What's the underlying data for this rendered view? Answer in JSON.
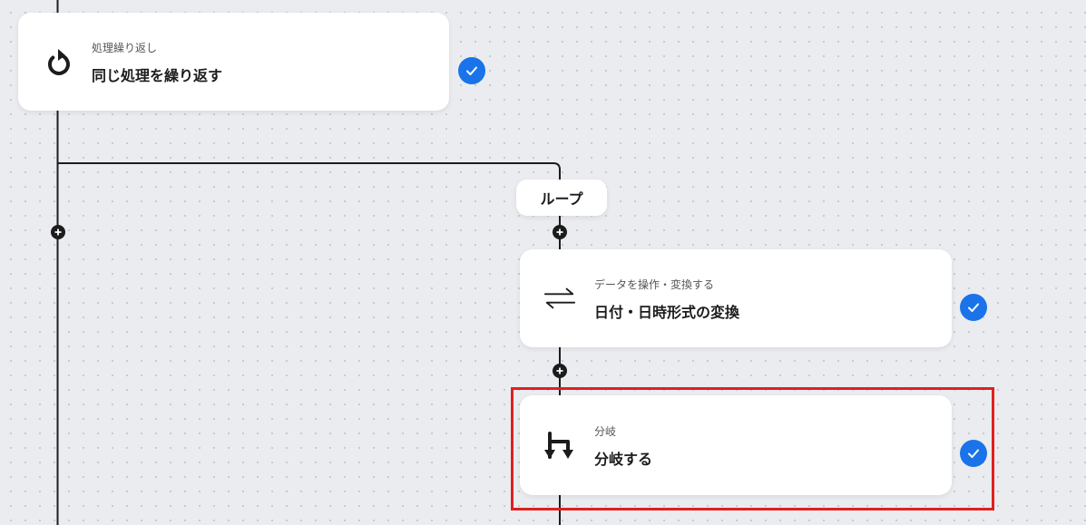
{
  "flow": {
    "repeat_card": {
      "subtitle": "処理繰り返し",
      "title": "同じ処理を繰り返す",
      "icon": "repeat-icon",
      "status": "completed"
    },
    "loop_label": "ループ",
    "convert_card": {
      "subtitle": "データを操作・変換する",
      "title": "日付・日時形式の変換",
      "icon": "convert-arrows-icon",
      "status": "completed"
    },
    "branch_card": {
      "subtitle": "分岐",
      "title": "分岐する",
      "icon": "branch-icon",
      "status": "completed",
      "highlighted": true
    }
  },
  "colors": {
    "accent": "#1a73e8",
    "highlight": "#e02020",
    "line": "#1c1c1c",
    "background": "#eaecf0"
  }
}
